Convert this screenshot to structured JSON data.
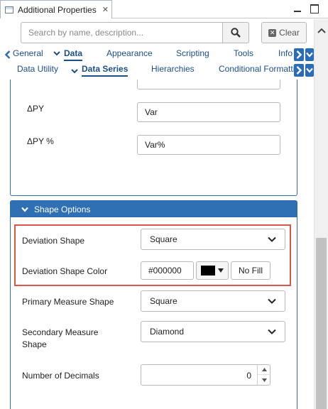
{
  "window": {
    "tab_title": "Additional Properties",
    "tab_close": "✕"
  },
  "search": {
    "placeholder": "Search by name, description...",
    "clear_label": "Clear"
  },
  "tabs_primary": [
    {
      "label": "General",
      "active": false
    },
    {
      "label": "Data",
      "active": true
    },
    {
      "label": "Appearance",
      "active": false
    },
    {
      "label": "Scripting",
      "active": false
    },
    {
      "label": "Tools",
      "active": false
    },
    {
      "label": "Info",
      "active": false
    }
  ],
  "tabs_secondary": [
    {
      "label": "Data Utility",
      "active": false
    },
    {
      "label": "Data Series",
      "active": true
    },
    {
      "label": "Hierarchies",
      "active": false
    },
    {
      "label": "Conditional Formatting",
      "active": false
    }
  ],
  "upper_fields": [
    {
      "label": "ΔPY",
      "value": "Var"
    },
    {
      "label": "ΔPY %",
      "value": "Var%"
    }
  ],
  "shape_options": {
    "header": "Shape Options",
    "deviation_shape": {
      "label": "Deviation Shape",
      "value": "Square"
    },
    "deviation_shape_color": {
      "label": "Deviation Shape Color",
      "value": "#000000",
      "swatch_color": "#000000",
      "no_fill_label": "No Fill"
    },
    "primary_measure_shape": {
      "label": "Primary Measure Shape",
      "value": "Square"
    },
    "secondary_measure_shape": {
      "label_line1": "Secondary Measure",
      "label_line2": "Shape",
      "value": "Diamond"
    },
    "number_of_decimals": {
      "label": "Number of Decimals",
      "value": "0"
    }
  },
  "colors": {
    "accent": "#2f6fb4",
    "highlight": "#d9574b",
    "tab_text": "#1a4f8b"
  }
}
